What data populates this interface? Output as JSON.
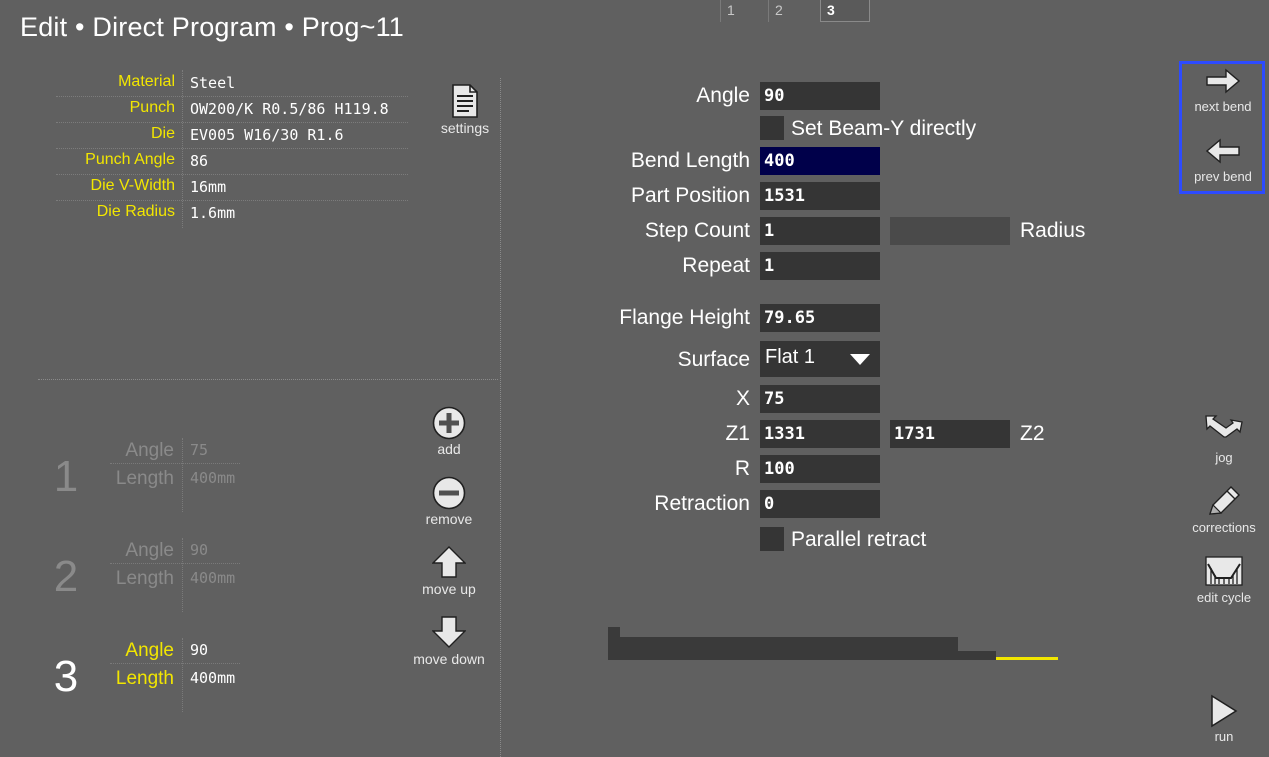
{
  "header": {
    "title": "Edit  •  Direct Program  •  Prog~11",
    "tabs": [
      {
        "label": "1",
        "active": false
      },
      {
        "label": "2",
        "active": false
      },
      {
        "label": "3",
        "active": true
      }
    ]
  },
  "tooling": {
    "rows": [
      {
        "label": "Material",
        "value": "Steel"
      },
      {
        "label": "Punch",
        "value": "OW200/K R0.5/86 H119.8"
      },
      {
        "label": "Die",
        "value": "EV005 W16/30 R1.6"
      },
      {
        "label": "Punch Angle",
        "value": "86"
      },
      {
        "label": "Die V-Width",
        "value": "16mm"
      },
      {
        "label": "Die Radius",
        "value": "1.6mm"
      }
    ],
    "settings_label": "settings"
  },
  "bend_actions": {
    "add": "add",
    "remove": "remove",
    "move_up": "move up",
    "move_down": "move down"
  },
  "bends": [
    {
      "number": "1",
      "angle_label": "Angle",
      "angle": "75",
      "length_label": "Length",
      "length": "400mm",
      "active": false
    },
    {
      "number": "2",
      "angle_label": "Angle",
      "angle": "90",
      "length_label": "Length",
      "length": "400mm",
      "active": false
    },
    {
      "number": "3",
      "angle_label": "Angle",
      "angle": "90",
      "length_label": "Length",
      "length": "400mm",
      "active": true
    }
  ],
  "form": {
    "angle_label": "Angle",
    "angle": "90",
    "set_beam_label": "Set Beam-Y directly",
    "bend_length_label": "Bend Length",
    "bend_length": "400",
    "part_position_label": "Part Position",
    "part_position": "1531",
    "step_count_label": "Step Count",
    "step_count": "1",
    "radius_label": "Radius",
    "radius": "",
    "repeat_label": "Repeat",
    "repeat": "1",
    "flange_height_label": "Flange Height",
    "flange_height": "79.65",
    "surface_label": "Surface",
    "surface": "Flat 1",
    "x_label": "X",
    "x": "75",
    "z1_label": "Z1",
    "z1": "1331",
    "z2_label": "Z2",
    "z2": "1731",
    "r_label": "R",
    "r": "100",
    "retraction_label": "Retraction",
    "retraction": "0",
    "parallel_retract_label": "Parallel retract"
  },
  "side": {
    "next_bend": "next bend",
    "prev_bend": "prev bend",
    "jog": "jog",
    "corrections": "corrections",
    "edit_cycle": "edit cycle",
    "run": "run"
  },
  "colors": {
    "background": "#606060",
    "label_accent": "#f2e600",
    "input_bg": "#353535",
    "selected_input_bg": "#00004a",
    "nav_highlight": "#2d4bff"
  }
}
